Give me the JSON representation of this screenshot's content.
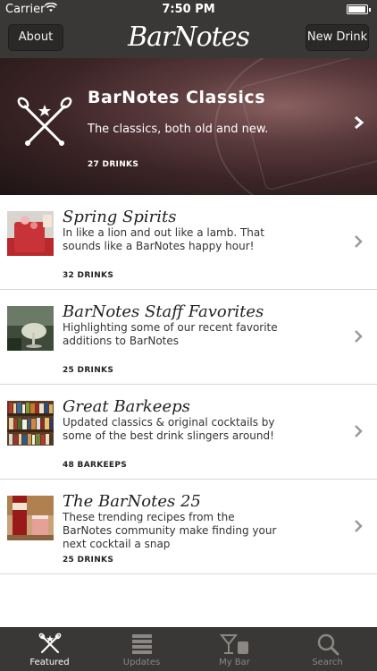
{
  "status": {
    "carrier": "Carrier",
    "time": "7:50 PM"
  },
  "navbar": {
    "about_label": "About",
    "logo": "BarNotes",
    "new_drink_label": "New Drink"
  },
  "hero": {
    "title": "BarNotes Classics",
    "subtitle": "The classics, both old and new.",
    "count": "27 DRINKS"
  },
  "items": [
    {
      "title": "Spring Spirits",
      "desc": "In like a lion and out like a lamb. That sounds like a BarNotes happy hour!",
      "count": "32 DRINKS"
    },
    {
      "title": "BarNotes Staff Favorites",
      "desc": "Highlighting some of our recent favorite additions to BarNotes",
      "count": "25 DRINKS"
    },
    {
      "title": "Great Barkeeps",
      "desc": "Updated classics & original cocktails by some of the best drink slingers around!",
      "count": "48 BARKEEPS"
    },
    {
      "title": "The BarNotes 25",
      "desc": "These trending recipes from the BarNotes community make finding your next cocktail a snap",
      "count": "25 DRINKS"
    }
  ],
  "tabs": [
    {
      "label": "Featured",
      "icon": "crossed-spoons-icon"
    },
    {
      "label": "Updates",
      "icon": "list-icon"
    },
    {
      "label": "My Bar",
      "icon": "glasses-icon"
    },
    {
      "label": "Search",
      "icon": "magnifier-icon"
    }
  ]
}
